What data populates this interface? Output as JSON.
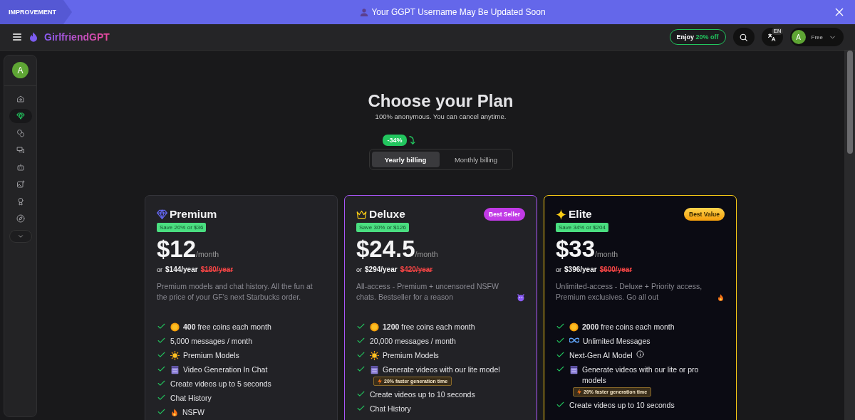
{
  "banner": {
    "tag": "IMPROVEMENT",
    "message": "Your GGPT Username May Be Updated Soon"
  },
  "nav": {
    "brand": "GirlfriendGPT",
    "promo_prefix": "Enjoy",
    "promo_highlight": "20% off",
    "language": "EN",
    "avatar": "A",
    "plan": "Free"
  },
  "sidebar": {
    "avatar": "A",
    "items": [
      {
        "kind": "home",
        "selected": false
      },
      {
        "kind": "gem",
        "selected": true
      },
      {
        "kind": "coins",
        "selected": false
      },
      {
        "kind": "chats",
        "selected": false
      },
      {
        "kind": "bot",
        "selected": false
      },
      {
        "kind": "image",
        "selected": false
      },
      {
        "kind": "award",
        "selected": false
      },
      {
        "kind": "compass",
        "selected": false
      }
    ]
  },
  "header": {
    "title": "Choose your Plan",
    "subtitle": "100% anonymous. You can cancel anytime."
  },
  "billing": {
    "discount": "-34%",
    "options": [
      {
        "label": "Yearly billing",
        "selected": true
      },
      {
        "label": "Monthly billing",
        "selected": false
      }
    ]
  },
  "plans": [
    {
      "kind": "premium",
      "name": "Premium",
      "save": "Save 20% or $36",
      "price": "$12",
      "period": "/month",
      "yearly_prefix": "or",
      "yearly": "$144/year",
      "original": "$180/year",
      "description": {
        "text": "Premium models and chat history. All the fun at the price of your GF's next Starbucks order.",
        "kind": "plain"
      },
      "features": [
        {
          "kind": "coin",
          "text": "**400** free coins each month"
        },
        {
          "kind": "plain",
          "text": "5,000 messages / month"
        },
        {
          "kind": "sun",
          "text": "Premium Models"
        },
        {
          "kind": "film",
          "text": "Video Generation In Chat"
        },
        {
          "kind": "plain",
          "text": "Create videos up to 5 seconds"
        },
        {
          "kind": "plain",
          "text": "Chat History"
        },
        {
          "kind": "flame",
          "text": "NSFW"
        }
      ]
    },
    {
      "kind": "deluxe",
      "name": "Deluxe",
      "badge": "Best Seller",
      "save": "Save 30% or $126",
      "price": "$24.5",
      "period": "/month",
      "yearly_prefix": "or",
      "yearly": "$294/year",
      "original": "$420/year",
      "description": {
        "text": "All-access - Premium + uncensored NSFW chats. Bestseller for a reason",
        "kind": "devil"
      },
      "features": [
        {
          "kind": "coin",
          "text": "**1200** free coins each month"
        },
        {
          "kind": "plain",
          "text": "20,000 messages / month"
        },
        {
          "kind": "sun",
          "text": "Premium Models"
        },
        {
          "kind": "film",
          "text": "Generate videos with our lite model",
          "note": "20% faster generation time"
        },
        {
          "kind": "plain",
          "text": "Create videos up to 10 seconds"
        },
        {
          "kind": "plain",
          "text": "Chat History"
        }
      ]
    },
    {
      "kind": "elite",
      "name": "Elite",
      "badge": "Best Value",
      "save": "Save 34% or $204",
      "price": "$33",
      "period": "/month",
      "yearly_prefix": "or",
      "yearly": "$396/year",
      "original": "$600/year",
      "description": {
        "text": "Unlimited-access - Deluxe + Priority access, Premium exclusives. Go all out",
        "kind": "flame"
      },
      "features": [
        {
          "kind": "coin",
          "text": "**2000** free coins each month"
        },
        {
          "kind": "infinity",
          "text": "Unlimited Messages"
        },
        {
          "kind": "info",
          "text": "Next-Gen AI Model"
        },
        {
          "kind": "film",
          "text": "Generate videos with our lite or pro models",
          "note": "20% faster generation time"
        },
        {
          "kind": "plain",
          "text": "Create videos up to 10 seconds"
        }
      ]
    }
  ]
}
